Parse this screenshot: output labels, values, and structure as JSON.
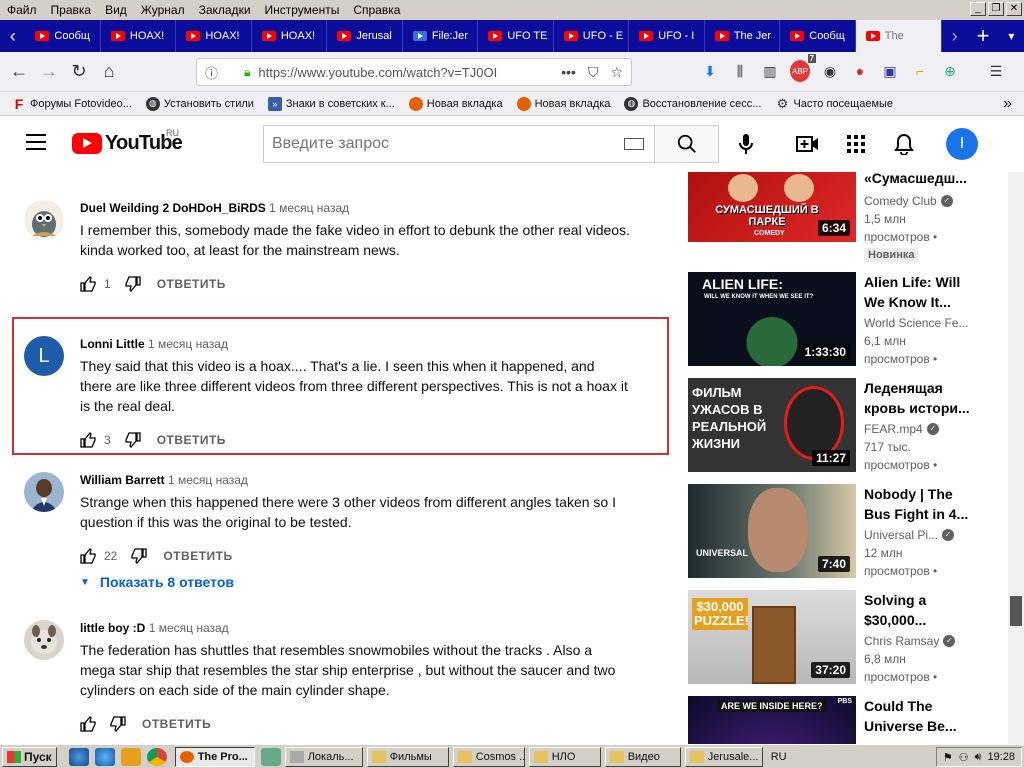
{
  "menubar": {
    "items": [
      "Файл",
      "Правка",
      "Вид",
      "Журнал",
      "Закладки",
      "Инструменты",
      "Справка"
    ]
  },
  "tabs": [
    {
      "label": "Сообщ"
    },
    {
      "label": "HOAX!"
    },
    {
      "label": "HOAX!"
    },
    {
      "label": "HOAX!"
    },
    {
      "label": "Jerusal"
    },
    {
      "label": "File:Jer"
    },
    {
      "label": "UFO TE"
    },
    {
      "label": "UFO - E"
    },
    {
      "label": "UFO - I"
    },
    {
      "label": "The Jer"
    },
    {
      "label": "Сообщ"
    },
    {
      "label": "The"
    }
  ],
  "address": {
    "url": "https://www.youtube.com/watch?v=TJ0OI"
  },
  "toolbar": {
    "badge_count": "7"
  },
  "bookmarks": [
    {
      "label": "Форумы Fotovideo..."
    },
    {
      "label": "Установить стили"
    },
    {
      "label": "Знаки в советских к..."
    },
    {
      "label": "Новая вкладка"
    },
    {
      "label": "Новая вкладка"
    },
    {
      "label": "Восстановление сесс..."
    },
    {
      "label": "Часто посещаемые"
    }
  ],
  "youtube": {
    "logo_text": "YouTube",
    "region": "RU",
    "search_placeholder": "Введите запрос",
    "avatar_letter": "I"
  },
  "comments": [
    {
      "author": "Duel Weilding 2 DoHDoH_BiRDS",
      "time": "1 месяц назад",
      "lines": [
        "I remember this, somebody made the fake video in effort to debunk the other real videos.",
        "kinda worked too, at least for the mainstream news."
      ],
      "likes": "1",
      "reply": "ОТВЕТИТЬ"
    },
    {
      "author": "Lonni Little",
      "time": "1 месяц назад",
      "avatar_letter": "L",
      "lines": [
        "They said that this video is a hoax.... That's a lie. I seen this when it happened, and there are like three different videos from three different perspectives. This is not a hoax it is the real deal."
      ],
      "likes": "3",
      "reply": "ОТВЕТИТЬ"
    },
    {
      "author": "William Barrett",
      "time": "1 месяц назад",
      "lines": [
        "Strange when this happened there were 3 other videos from different angles taken so I question if this was the original to be tested."
      ],
      "likes": "22",
      "reply": "ОТВЕТИТЬ",
      "show_replies": "Показать 8 ответов"
    },
    {
      "author": "little boy :D",
      "time": "1 месяц назад",
      "lines": [
        "The federation has shuttles that resembles snowmobiles without the tracks . Also a mega star ship that resembles the star ship enterprise , but without the saucer and two cylinders on each side of the main cylinder shape."
      ],
      "likes": "",
      "reply": "ОТВЕТИТЬ"
    }
  ],
  "sidebar_partial_title": "«Сумасшедш...",
  "videos": [
    {
      "title_lines": [
        "«Сумасшедш..."
      ],
      "channel": "Comedy Club",
      "views": "1,5 млн",
      "views2": "просмотров •",
      "badge": "Новинка",
      "duration": "6:34",
      "thumb_text": "СУМАСШЕДШИЙ В ПАРКЕ",
      "thumb_sub": "COMEDY"
    },
    {
      "title_lines": [
        "Alien Life: Will",
        "We Know It..."
      ],
      "channel": "World Science Fe...",
      "views": "6,1 млн",
      "views2": "просмотров •",
      "duration": "1:33:30",
      "thumb_text": "ALIEN LIFE:",
      "thumb_sub": "WILL WE KNOW IT WHEN WE SEE IT?"
    },
    {
      "title_lines": [
        "Леденящая",
        "кровь истори..."
      ],
      "channel": "FEAR.mp4",
      "views": "717 тыс.",
      "views2": "просмотров •",
      "duration": "11:27",
      "thumb_text": "ФИЛЬМ УЖАСОВ В РЕАЛЬНОЙ ЖИЗНИ"
    },
    {
      "title_lines": [
        "Nobody | The",
        "Bus Fight in 4..."
      ],
      "channel": "Universal Pi...",
      "views": "12 млн",
      "views2": "просмотров •",
      "duration": "7:40",
      "thumb_text": "UNIVERSAL"
    },
    {
      "title_lines": [
        "Solving a",
        "$30,000..."
      ],
      "channel": "Chris Ramsay",
      "views": "6,8 млн",
      "views2": "просмотров •",
      "duration": "37:20",
      "thumb_text": "$30,000 PUZZLE!"
    },
    {
      "title_lines": [
        "Could The",
        "Universe Be..."
      ],
      "thumb_text": "ARE WE INSIDE HERE?",
      "thumb_sub": "PBS"
    }
  ],
  "taskbar": {
    "start": "Пуск",
    "buttons": [
      "The Pro...",
      "Локаль...",
      "Фильмы",
      "Cosmos ...",
      "НЛО",
      "Видео",
      "Jerusale..."
    ],
    "lang": "RU",
    "clock": "19:28"
  },
  "colors": {
    "youtube_red": "#ff0000",
    "link_blue": "#065fd4",
    "highlight_border": "#d32f2f",
    "firefox_tabbar": "#0c0c9a"
  }
}
